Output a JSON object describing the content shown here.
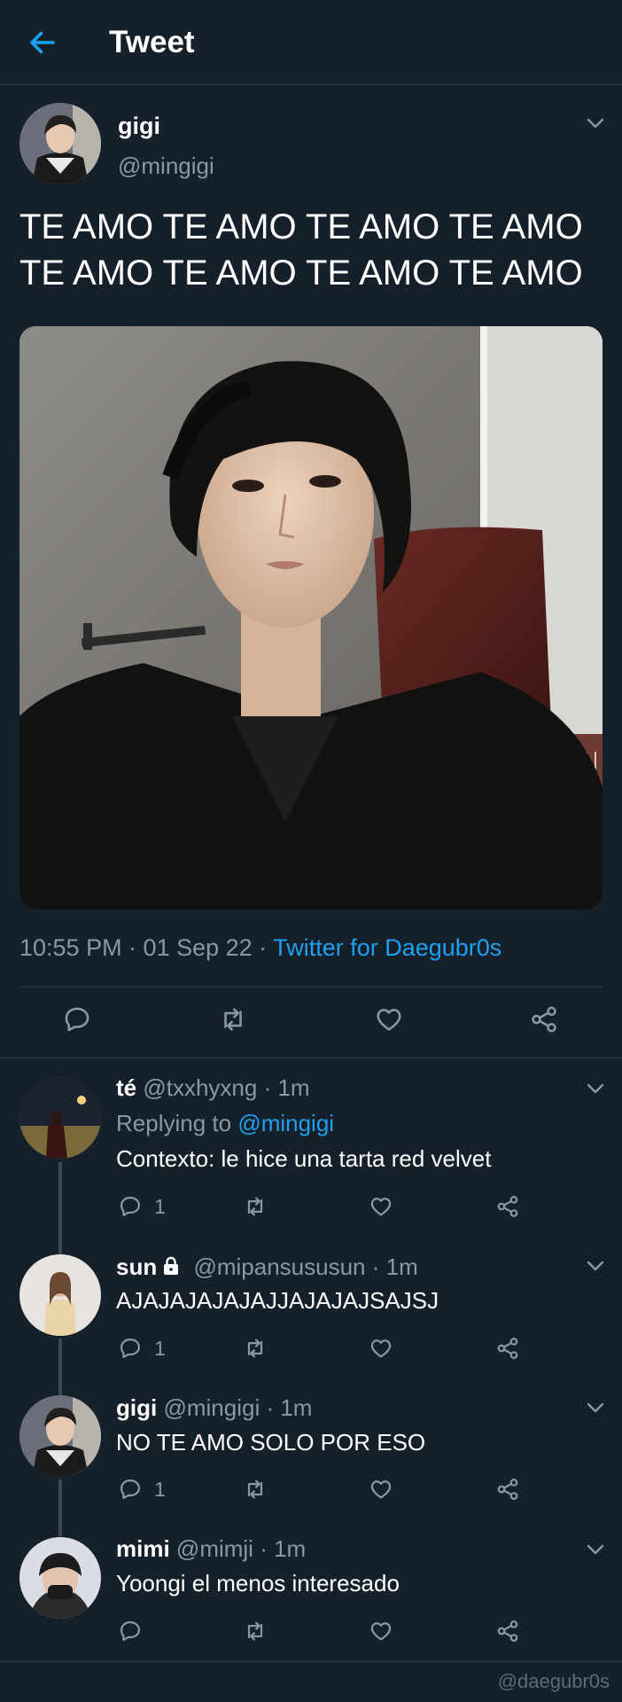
{
  "header": {
    "title": "Tweet"
  },
  "tweet": {
    "name": "gigi",
    "handle": "@mingigi",
    "text_line1": "TE AMO TE AMO TE AMO TE AMO",
    "text_line2": "TE AMO TE AMO TE AMO TE AMO",
    "time": "10:55 PM · 01 Sep 22 ·",
    "source": "Twitter for Daegubr0s"
  },
  "replies": [
    {
      "name": "té",
      "handle": "@txxhyxng",
      "time": "· 1m",
      "replying_prefix": "Replying to",
      "replying_handle": "@mingigi",
      "text": "Contexto: le hice una tarta red velvet",
      "reply_count": "1"
    },
    {
      "name": "sun",
      "handle": "@mipansususun",
      "time": "· 1m",
      "text": "AJAJAJAJAJAJJAJAJAJSAJSJ",
      "reply_count": "1"
    },
    {
      "name": "gigi",
      "handle": "@mingigi",
      "time": "· 1m",
      "text": "NO TE AMO SOLO POR ESO",
      "reply_count": "1"
    },
    {
      "name": "mimi",
      "handle": "@mimji",
      "time": "· 1m",
      "text": "Yoongi el menos interesado",
      "reply_count": ""
    }
  ],
  "watermark": "@daegubr0s",
  "colors": {
    "background": "#15202b",
    "accent": "#1da1f2",
    "secondary_text": "#8899a6",
    "divider": "#2f3d4a"
  },
  "icons": [
    "back-arrow-icon",
    "chevron-down-icon",
    "reply-icon",
    "retweet-icon",
    "like-icon",
    "share-icon",
    "lock-icon"
  ]
}
